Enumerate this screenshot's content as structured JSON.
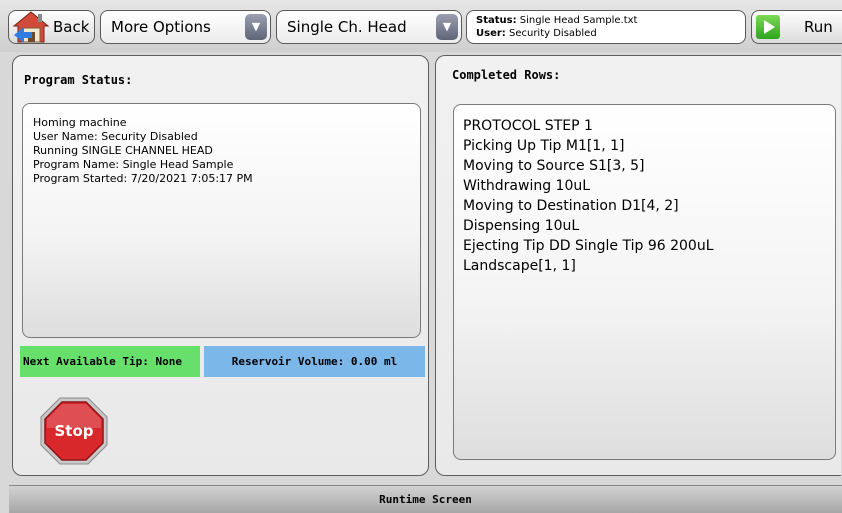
{
  "toolbar": {
    "back_label": "Back",
    "options_label": "More Options",
    "head_label": "Single Ch. Head",
    "status_label": "Status:",
    "status_value": "Single Head Sample.txt",
    "user_label": "User:",
    "user_value": "Security Disabled",
    "run_label": "Run"
  },
  "left_panel": {
    "title": "Program Status:",
    "lines": [
      "Homing machine",
      "User Name: Security Disabled",
      "Running SINGLE CHANNEL HEAD",
      "Program Name: Single Head Sample",
      "Program Started: 7/20/2021 7:05:17 PM"
    ],
    "next_tip": "Next Available Tip: None",
    "reservoir": "Reservoir Volume: 0.00 ml",
    "stop_label": "Stop"
  },
  "right_panel": {
    "title": "Completed Rows:",
    "rows": [
      "PROTOCOL STEP 1",
      "Picking Up Tip M1[1, 1]",
      "Moving to Source S1[3, 5]",
      "Withdrawing 10uL",
      "Moving to Destination D1[4, 2]",
      "Dispensing 10uL",
      "Ejecting Tip DD Single Tip 96 200uL",
      "Landscape[1, 1]"
    ]
  },
  "footer": {
    "label": "Runtime Screen"
  },
  "icons": {
    "back": "home-icon",
    "dropdown": "chevron-down-icon",
    "run": "play-icon",
    "stop": "stop-sign-icon"
  },
  "colors": {
    "next_tip_bg": "#66e06a",
    "reservoir_bg": "#7cb7ea",
    "stop_red": "#d8282c",
    "run_green": "#2ea41c"
  }
}
